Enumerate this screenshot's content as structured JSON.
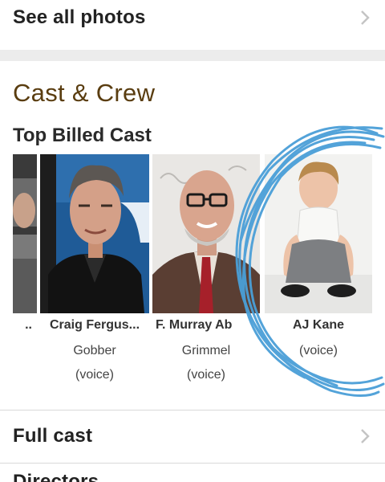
{
  "links": {
    "see_all_photos": "See all photos",
    "full_cast": "Full cast",
    "directors": "Directors"
  },
  "section": {
    "title": "Cast & Crew",
    "subtitle": "Top Billed Cast"
  },
  "cast": [
    {
      "name": "..",
      "role": "",
      "role2": ""
    },
    {
      "name": "Craig Fergus...",
      "role": "Gobber",
      "role2": "(voice)"
    },
    {
      "name": "F. Murray Ab",
      "role": "Grimmel",
      "role2": "(voice)"
    },
    {
      "name": "AJ Kane",
      "role": "(voice)",
      "role2": ""
    }
  ],
  "icons": {
    "chevron": "chevron-right-icon",
    "scribble": "blue-pen-scribble"
  },
  "colors": {
    "section_title": "#5a3d10",
    "scribble": "#4a9fd8",
    "band": "#ececec"
  }
}
